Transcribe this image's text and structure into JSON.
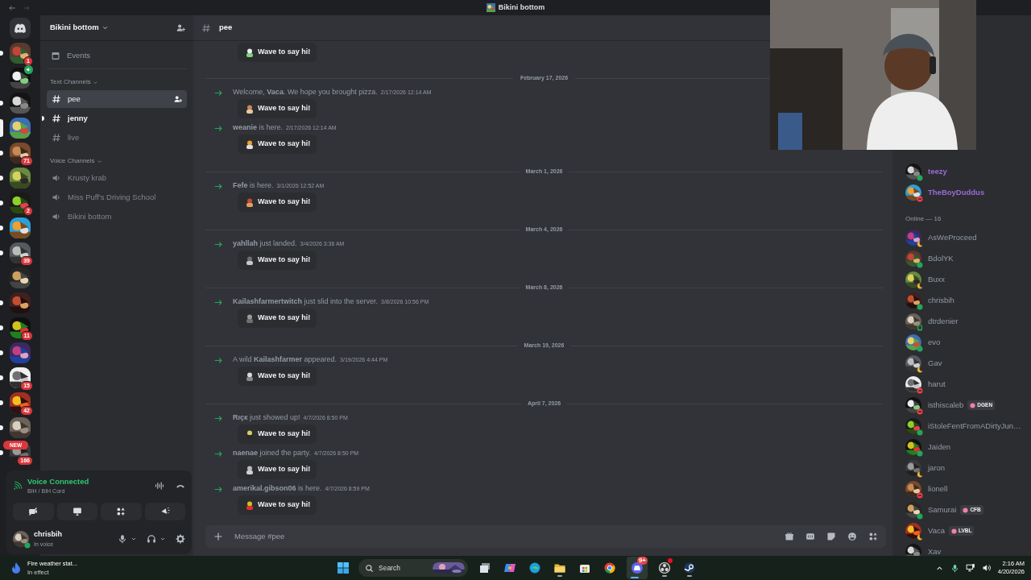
{
  "window": {
    "title": "Bikini bottom"
  },
  "servers": [
    {
      "unread": true,
      "selected": false,
      "voice": false,
      "badge": "1"
    },
    {
      "unread": false,
      "selected": false,
      "voice": true
    },
    {
      "unread": true,
      "selected": false,
      "voice": false
    },
    {
      "unread": false,
      "selected": true,
      "voice": false
    },
    {
      "unread": true,
      "selected": false,
      "voice": false,
      "badge": "71"
    },
    {
      "unread": true,
      "selected": false,
      "voice": false
    },
    {
      "unread": true,
      "selected": false,
      "voice": false,
      "badge": "2"
    },
    {
      "unread": true,
      "selected": false,
      "voice": false
    },
    {
      "unread": true,
      "selected": false,
      "voice": false,
      "badge": "39"
    },
    {
      "unread": false,
      "selected": false,
      "voice": false
    },
    {
      "unread": true,
      "selected": false,
      "voice": false
    },
    {
      "unread": true,
      "selected": false,
      "voice": false,
      "badge": "11"
    },
    {
      "unread": true,
      "selected": false,
      "voice": false
    },
    {
      "unread": true,
      "selected": false,
      "voice": false,
      "badge": "15"
    },
    {
      "unread": true,
      "selected": false,
      "voice": false,
      "badge": "42"
    },
    {
      "unread": true,
      "selected": false,
      "voice": false
    },
    {
      "unread": true,
      "selected": false,
      "voice": false,
      "badge": "166",
      "label": "NEW"
    }
  ],
  "guild": {
    "name": "Bikini bottom",
    "events": "Events",
    "categories": [
      {
        "name": "Text Channels",
        "kind": "text",
        "channels": [
          {
            "name": "pee",
            "selected": true,
            "unread": false
          },
          {
            "name": "jenny",
            "selected": false,
            "unread": true
          },
          {
            "name": "live",
            "selected": false,
            "unread": false
          }
        ]
      },
      {
        "name": "Voice Channels",
        "kind": "voice",
        "channels": [
          {
            "name": "Krusty krab",
            "selected": false,
            "unread": false
          },
          {
            "name": "Miss Puff's Driving School",
            "selected": false,
            "unread": false
          },
          {
            "name": "Bikini bottom",
            "selected": false,
            "unread": false
          }
        ]
      }
    ]
  },
  "voice": {
    "status": "Voice Connected",
    "channel": "BIH / BIH Cord"
  },
  "user": {
    "name": "chrisbih",
    "activity": "In voice"
  },
  "chat": {
    "channel": "pee",
    "messages": [
      {
        "kind": "wave",
        "wave": "Wave to say hi!"
      },
      {
        "kind": "date",
        "text": "February 17, 2026"
      },
      {
        "kind": "join",
        "text": "Welcome, **Vaca**. We hope you brought pizza.",
        "time": "2/17/2026 12:14 AM",
        "wave": "Wave to say hi!"
      },
      {
        "kind": "join",
        "text": "**weanie** is here.",
        "time": "2/17/2026 12:14 AM",
        "wave": "Wave to say hi!"
      },
      {
        "kind": "date",
        "text": "March 1, 2026"
      },
      {
        "kind": "join",
        "text": "**Fefe** is here.",
        "time": "3/1/2026 12:52 AM",
        "wave": "Wave to say hi!"
      },
      {
        "kind": "date",
        "text": "March 4, 2026"
      },
      {
        "kind": "join",
        "text": "**yahllah** just landed.",
        "time": "3/4/2026 3:36 AM",
        "wave": "Wave to say hi!"
      },
      {
        "kind": "date",
        "text": "March 8, 2026"
      },
      {
        "kind": "join",
        "text": "**Kailashfarmertwitch** just slid into the server.",
        "time": "3/8/2026 10:56 PM",
        "wave": "Wave to say hi!"
      },
      {
        "kind": "date",
        "text": "March 19, 2026"
      },
      {
        "kind": "join",
        "text": "A wild **Kailashfarmer** appeared.",
        "time": "3/19/2026 4:44 PM",
        "wave": "Wave to say hi!"
      },
      {
        "kind": "date",
        "text": "April 7, 2026"
      },
      {
        "kind": "join",
        "text": "**Rıçк** just showed up!",
        "time": "4/7/2026 8:50 PM",
        "wave": "Wave to say hi!"
      },
      {
        "kind": "join",
        "text": "**naenae** joined the party.",
        "time": "4/7/2026 8:50 PM",
        "wave": "Wave to say hi!"
      },
      {
        "kind": "join",
        "text": "**amerikal.gibson06** is here.",
        "time": "4/7/2026 8:59 PM",
        "wave": "Wave to say hi!"
      }
    ],
    "input": {
      "placeholder": "Message #pee"
    }
  },
  "members": [
    {
      "color": "#9b6ad6",
      "members": [
        {
          "name": "teezy",
          "color": "#23a55a",
          "mobile": false
        },
        {
          "name": "TheBoyDuddus",
          "color": "#f23f43",
          "mobile": false
        }
      ]
    },
    {
      "header": "Online — 16",
      "members": [
        {
          "name": "AsWeProceed",
          "color": "#f0b232",
          "mobile": false
        },
        {
          "name": "BdolYK",
          "color": "#23a55a",
          "mobile": false
        },
        {
          "name": "Buxx",
          "color": "#f0b232",
          "mobile": false
        },
        {
          "name": "chrisbih",
          "color": "#23a55a",
          "mobile": false
        },
        {
          "name": "dtrdenier",
          "color": "#23a55a",
          "mobile": true
        },
        {
          "name": "evo",
          "color": "#23a55a",
          "mobile": false
        },
        {
          "name": "Gav",
          "color": "#f0b232",
          "mobile": false
        },
        {
          "name": "harut",
          "color": "#f23f43",
          "mobile": false
        },
        {
          "name": "isthiscaleb",
          "color": "#f23f43",
          "mobile": false,
          "tag": "DGEN"
        },
        {
          "name": "iStoleFentFromADirtyJun…",
          "color": "#23a55a",
          "mobile": false
        },
        {
          "name": "Jaiden",
          "color": "#23a55a",
          "mobile": false
        },
        {
          "name": "jaron",
          "color": "#f0b232",
          "mobile": false
        },
        {
          "name": "lionell",
          "color": "#f23f43",
          "mobile": false
        },
        {
          "name": "Samurai",
          "color": "#23a55a",
          "mobile": false,
          "tag": "CFB"
        },
        {
          "name": "Vaca",
          "color": "#f0b232",
          "mobile": false,
          "tag": "LVBL"
        },
        {
          "name": "Xav"
        }
      ]
    }
  ],
  "taskbar": {
    "weather": {
      "title": "Fire weather stat...",
      "subtitle": "In effect"
    },
    "search": {
      "placeholder": "Search"
    },
    "apps": [
      {
        "running": false,
        "active": false
      },
      {
        "running": false,
        "active": false
      },
      {
        "running": false,
        "active": false
      },
      {
        "running": true,
        "active": false
      },
      {
        "running": false,
        "active": false
      },
      {
        "running": false,
        "active": false
      },
      {
        "running": true,
        "active": true,
        "badge": "9+"
      },
      {
        "running": true,
        "active": false,
        "alert": true
      },
      {
        "running": true,
        "active": false
      }
    ],
    "time": "2:16 AM",
    "date": "4/20/2026"
  }
}
